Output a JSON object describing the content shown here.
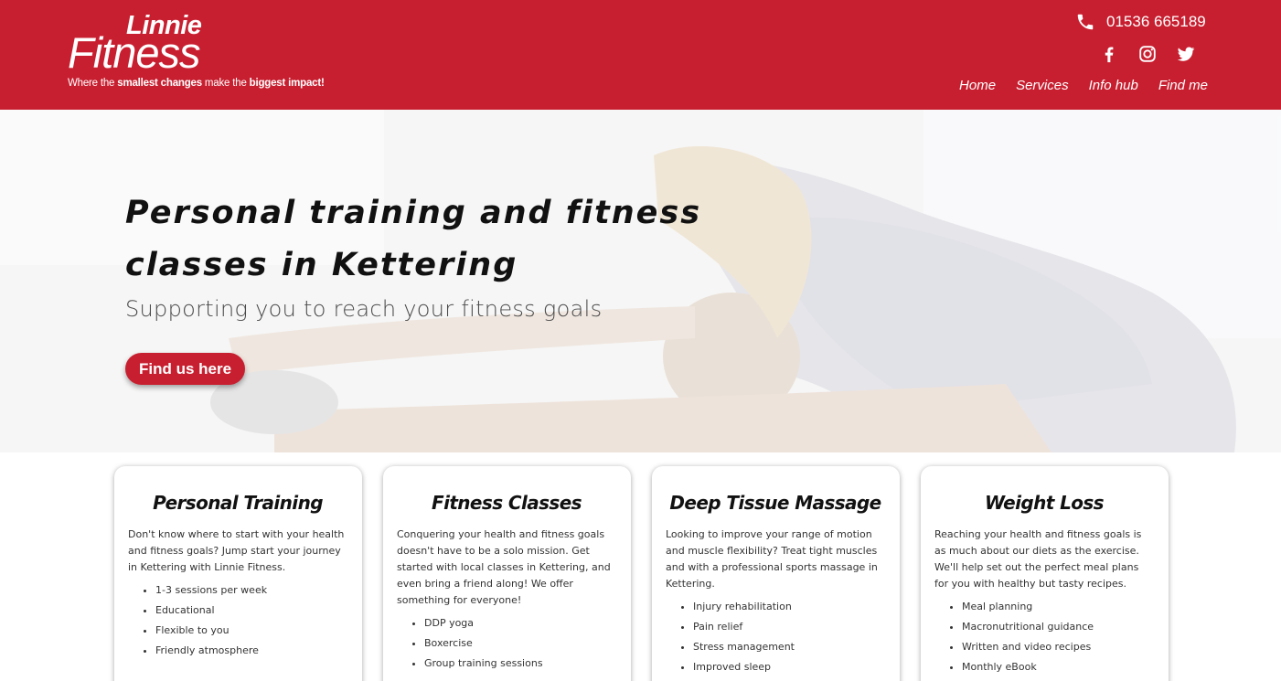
{
  "header": {
    "logo_top": "Linnie",
    "logo_bottom": "Fitness",
    "tagline_parts": [
      "Where the ",
      "smallest changes",
      " make the ",
      "biggest impact!"
    ],
    "phone": "01536 665189",
    "social": [
      "facebook-icon",
      "instagram-icon",
      "twitter-icon"
    ],
    "nav": [
      "Home",
      "Services",
      "Info hub",
      "Find me"
    ],
    "brand_color": "#c81f30"
  },
  "hero": {
    "title_line1": "Personal training and fitness",
    "title_line2": "classes in Kettering",
    "subtitle": "Supporting you to reach your fitness goals",
    "button_label": "Find us here"
  },
  "cards": [
    {
      "title": "Personal Training",
      "text": "Don't know where to start with your health and fitness goals? Jump start your journey in Kettering with Linnie Fitness.",
      "items": [
        "1-3 sessions per week",
        "Educational",
        "Flexible to you",
        "Friendly atmosphere"
      ]
    },
    {
      "title": "Fitness Classes",
      "text": "Conquering your health and fitness goals doesn't have to be a solo mission. Get started with local classes in Kettering, and even bring a friend along! We offer something for everyone!",
      "items": [
        "DDP yoga",
        "Boxercise",
        "Group training sessions"
      ]
    },
    {
      "title": "Deep Tissue Massage",
      "text": "Looking to improve your range of motion and muscle flexibility? Treat tight muscles and with a professional sports massage in Kettering.",
      "items": [
        "Injury rehabilitation",
        "Pain relief",
        "Stress management",
        "Improved sleep"
      ]
    },
    {
      "title": "Weight Loss",
      "text": "Reaching your health and fitness goals is as much about our diets as the exercise. We'll help set out the perfect meal plans for you with healthy but tasty recipes.",
      "items": [
        "Meal planning",
        "Macronutritional guidance",
        "Written and video recipes",
        "Monthly eBook"
      ]
    }
  ]
}
